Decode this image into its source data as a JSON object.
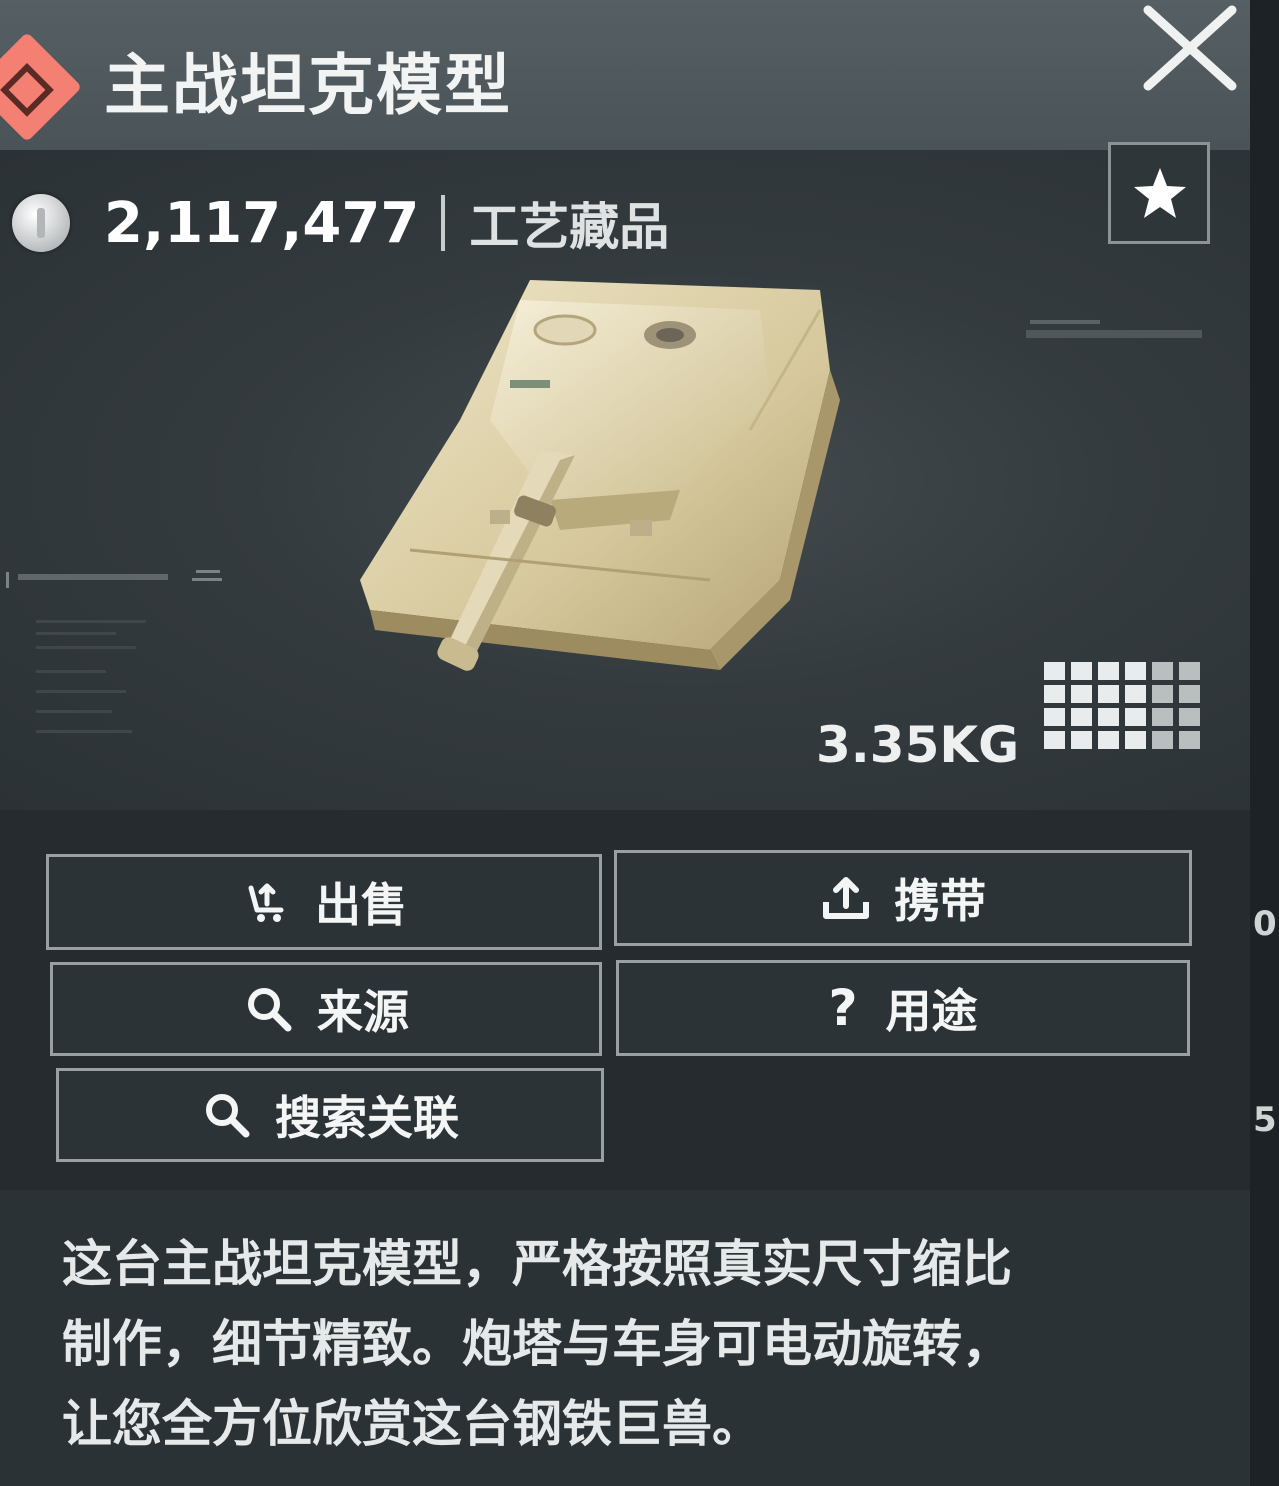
{
  "header": {
    "title": "主战坦克模型",
    "rarity_color": "#f47f73",
    "rarity_icon": "diamond-icon",
    "close_icon": "close-icon"
  },
  "item": {
    "price": "2,117,477",
    "currency_icon": "silver-coin-icon",
    "category": "工艺藏品",
    "favorite_icon": "star-icon",
    "weight": "3.35KG",
    "image": "main-battle-tank-model",
    "size_grid_icon": "inventory-grid-icon"
  },
  "actions": {
    "sell": {
      "label": "出售",
      "icon": "sell-exchange-icon"
    },
    "carry": {
      "label": "携带",
      "icon": "upload-icon"
    },
    "source": {
      "label": "来源",
      "icon": "search-icon"
    },
    "usage": {
      "label": "用途",
      "icon": "?"
    },
    "search_related": {
      "label": "搜索关联",
      "icon": "search-icon"
    }
  },
  "description": {
    "line1": "这台主战坦克模型，严格按照真实尺寸缩比",
    "line2": "制作，细节精致。炮塔与车身可电动旋转，",
    "line3": "让您全方位欣赏这台钢铁巨兽。"
  },
  "edge": {
    "char1": "0",
    "char2": "5"
  }
}
